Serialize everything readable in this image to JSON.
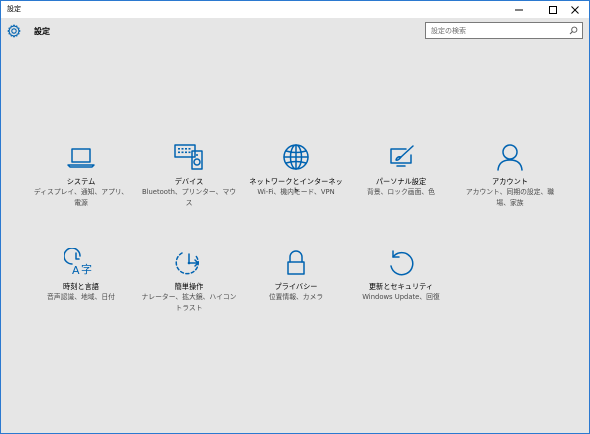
{
  "window": {
    "title": "設定"
  },
  "header": {
    "title": "設定"
  },
  "search": {
    "placeholder": "設定の検索"
  },
  "tiles": [
    {
      "label": "システム",
      "desc": "ディスプレイ、通知、アプリ、電源",
      "icon": "laptop-icon"
    },
    {
      "label": "デバイス",
      "desc": "Bluetooth、プリンター、マウス",
      "icon": "keyboard-speaker-icon"
    },
    {
      "label": "ネットワークとインターネット",
      "desc": "Wi-Fi、機内モード、VPN",
      "icon": "globe-icon"
    },
    {
      "label": "パーソナル設定",
      "desc": "背景、ロック画面、色",
      "icon": "paintbrush-icon"
    },
    {
      "label": "アカウント",
      "desc": "アカウント、同期の設定、職場、家族",
      "icon": "person-icon"
    },
    {
      "label": "時刻と言語",
      "desc": "音声認識、地域、日付",
      "icon": "clock-language-icon"
    },
    {
      "label": "簡単操作",
      "desc": "ナレーター、拡大鏡、ハイコントラスト",
      "icon": "ease-of-access-icon"
    },
    {
      "label": "プライバシー",
      "desc": "位置情報、カメラ",
      "icon": "lock-icon"
    },
    {
      "label": "更新とセキュリティ",
      "desc": "Windows Update、回復",
      "icon": "refresh-icon"
    }
  ]
}
